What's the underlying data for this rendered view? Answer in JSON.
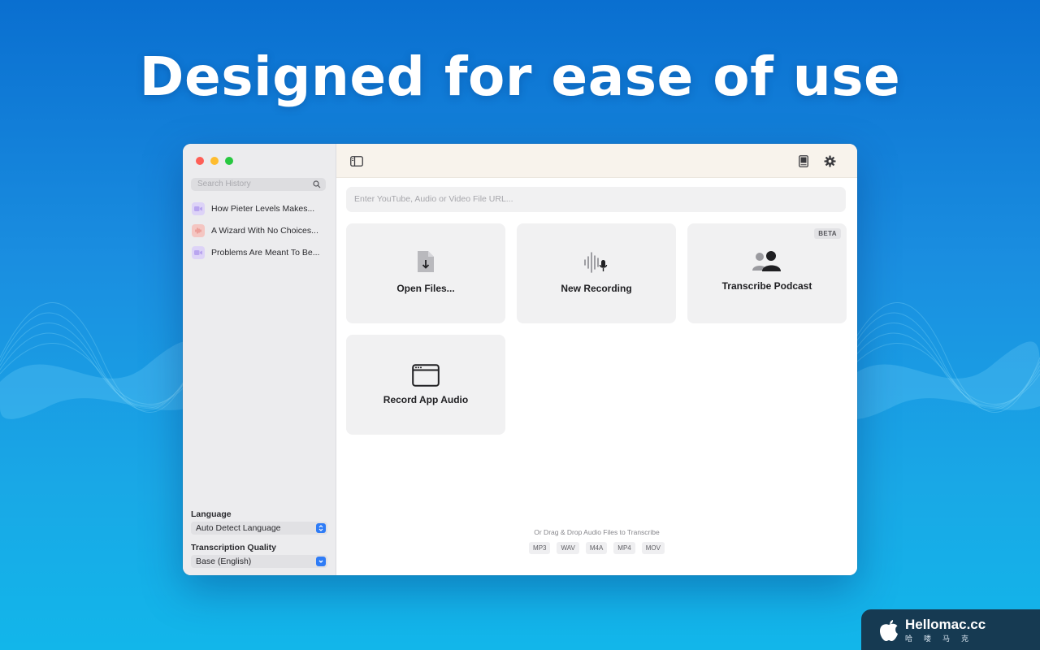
{
  "headline": "Designed for ease of use",
  "sidebar": {
    "search_placeholder": "Search History",
    "history": [
      {
        "title": "How Pieter Levels Makes...",
        "kind": "video-icon"
      },
      {
        "title": "A Wizard With No Choices...",
        "kind": "audio-icon"
      },
      {
        "title": "Problems Are Meant To Be...",
        "kind": "video-icon"
      }
    ],
    "language_label": "Language",
    "language_value": "Auto Detect Language",
    "quality_label": "Transcription Quality",
    "quality_value": "Base (English)"
  },
  "main": {
    "url_placeholder": "Enter YouTube, Audio or Video File URL...",
    "cards": [
      {
        "label": "Open Files...",
        "icon": "file-download-icon"
      },
      {
        "label": "New Recording",
        "icon": "waveform-mic-icon"
      },
      {
        "label": "Transcribe Podcast",
        "icon": "people-icon",
        "badge": "BETA"
      },
      {
        "label": "Record App Audio",
        "icon": "app-window-icon"
      }
    ],
    "drop_hint": "Or Drag & Drop Audio Files to Transcribe",
    "formats": [
      "MP3",
      "WAV",
      "M4A",
      "MP4",
      "MOV"
    ]
  },
  "watermark": {
    "brand": "Hellomac.cc",
    "sub": "哈喽马克"
  },
  "colors": {
    "accent": "#2f7cf6",
    "background_top": "#0a6fd0",
    "background_bottom": "#12b6ea"
  }
}
